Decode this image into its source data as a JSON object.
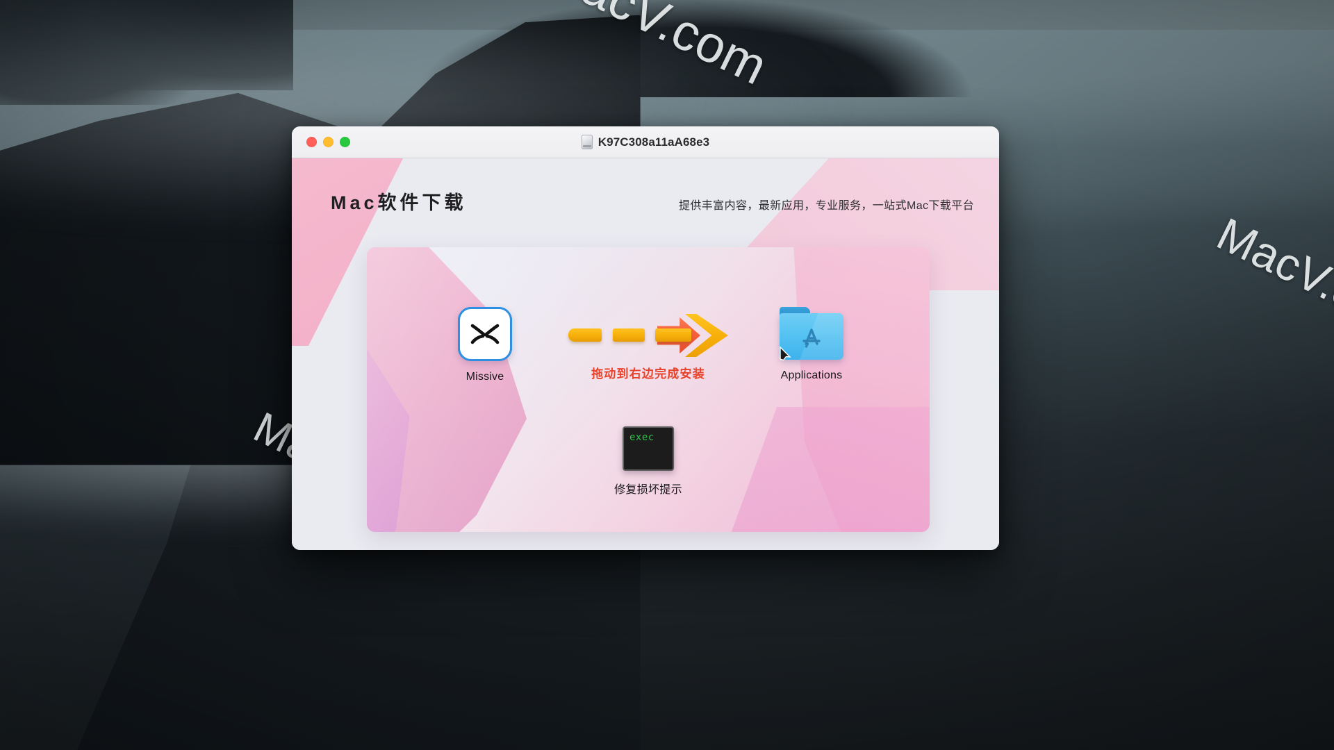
{
  "desktop": {
    "watermarks": [
      {
        "id": "top",
        "text": "MacV.com"
      },
      {
        "id": "right",
        "text": "MacV.co"
      },
      {
        "id": "left",
        "text": "MacV.com"
      }
    ]
  },
  "window": {
    "title": "K97C308a11aA68e3",
    "title_icon": "disk-drive-icon",
    "traffic_lights": [
      {
        "name": "close",
        "color": "#ff5f57"
      },
      {
        "name": "minimize",
        "color": "#febc2e"
      },
      {
        "name": "zoom",
        "color": "#28c840"
      }
    ],
    "header": {
      "brand": "Mac软件下载",
      "tagline": "提供丰富内容，最新应用，专业服务，一站式Mac下载平台"
    },
    "installer": {
      "app": {
        "label": "Missive",
        "icon": "missive-app-icon",
        "border_color": "#2f8fe0"
      },
      "drag_hint": {
        "text": "拖动到右边完成安装",
        "color": "#e8422a"
      },
      "destination": {
        "label": "Applications",
        "icon": "applications-folder-icon",
        "folder_color": "#55c2f2"
      },
      "repair": {
        "terminal_text": "exec",
        "terminal_text_color": "#2fc24a",
        "label": "修复损坏提示",
        "icon": "exec-script-icon"
      }
    }
  }
}
